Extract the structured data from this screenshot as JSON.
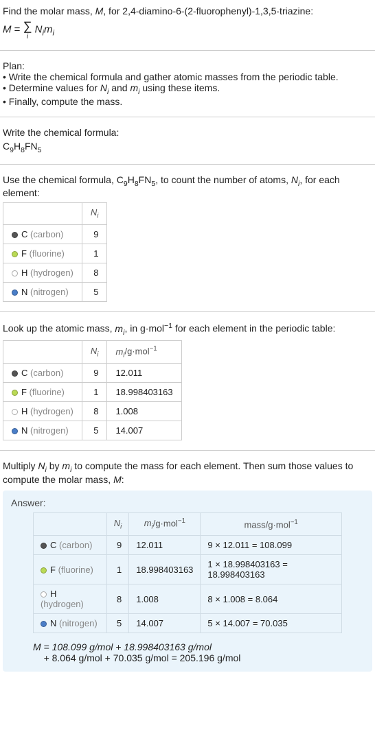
{
  "intro": {
    "line1_prefix": "Find the molar mass, ",
    "M": "M",
    "line1_suffix": ", for 2,4-diamino-6-(2-fluorophenyl)-1,3,5-triazine:",
    "eq_left": "M",
    "eq_eq": " = ",
    "sigma_i": "i",
    "eq_right1": "N",
    "eq_right2": "m",
    "eq_sub": "i"
  },
  "plan": {
    "title": "Plan:",
    "b1": "• Write the chemical formula and gather atomic masses from the periodic table.",
    "b2_prefix": "• Determine values for ",
    "Ni": "N",
    "mi": "m",
    "isub": "i",
    "b2_suffix": " using these items.",
    "b3": "• Finally, compute the mass."
  },
  "formula_section": {
    "title": "Write the chemical formula:",
    "C": "C",
    "C_n": "9",
    "H": "H",
    "H_n": "8",
    "F": "F",
    "N": "N",
    "N_n": "5"
  },
  "count_section": {
    "prefix": "Use the chemical formula, ",
    "suffix1": ", to count the number of atoms, ",
    "Ni": "N",
    "isub": "i",
    "suffix2": ", for each element:",
    "col_N": "N",
    "rows": [
      {
        "dot": "dot-c",
        "sym": "C",
        "name": "(carbon)",
        "n": "9"
      },
      {
        "dot": "dot-f",
        "sym": "F",
        "name": "(fluorine)",
        "n": "1"
      },
      {
        "dot": "dot-h",
        "sym": "H",
        "name": "(hydrogen)",
        "n": "8"
      },
      {
        "dot": "dot-n",
        "sym": "N",
        "name": "(nitrogen)",
        "n": "5"
      }
    ]
  },
  "mass_section": {
    "prefix": "Look up the atomic mass, ",
    "mi": "m",
    "isub": "i",
    "suffix": ", in g·mol",
    "exp": "−1",
    "suffix2": " for each element in the periodic table:",
    "col_N": "N",
    "col_m": "m",
    "col_m_unit": "/g·mol",
    "rows": [
      {
        "dot": "dot-c",
        "sym": "C",
        "name": "(carbon)",
        "n": "9",
        "m": "12.011"
      },
      {
        "dot": "dot-f",
        "sym": "F",
        "name": "(fluorine)",
        "n": "1",
        "m": "18.998403163"
      },
      {
        "dot": "dot-h",
        "sym": "H",
        "name": "(hydrogen)",
        "n": "8",
        "m": "1.008"
      },
      {
        "dot": "dot-n",
        "sym": "N",
        "name": "(nitrogen)",
        "n": "5",
        "m": "14.007"
      }
    ]
  },
  "multiply_section": {
    "prefix": "Multiply ",
    "Ni": "N",
    "mi": "m",
    "isub": "i",
    "mid": " by ",
    "suffix": " to compute the mass for each element. Then sum those values to compute the molar mass, ",
    "M": "M",
    "end": ":"
  },
  "answer": {
    "title": "Answer:",
    "col_N": "N",
    "col_m": "m",
    "unit": "/g·mol",
    "exp": "−1",
    "col_mass": "mass/g·mol",
    "rows": [
      {
        "dot": "dot-c",
        "sym": "C",
        "name": "(carbon)",
        "n": "9",
        "m": "12.011",
        "mass": "9 × 12.011 = 108.099"
      },
      {
        "dot": "dot-f",
        "sym": "F",
        "name": "(fluorine)",
        "n": "1",
        "m": "18.998403163",
        "mass": "1 × 18.998403163 = 18.998403163"
      },
      {
        "dot": "dot-h",
        "sym": "H",
        "name": "(hydrogen)",
        "n": "8",
        "m": "1.008",
        "mass": "8 × 1.008 = 8.064"
      },
      {
        "dot": "dot-n",
        "sym": "N",
        "name": "(nitrogen)",
        "n": "5",
        "m": "14.007",
        "mass": "5 × 14.007 = 70.035"
      }
    ],
    "final1": "M = 108.099 g/mol + 18.998403163 g/mol",
    "final2": "+ 8.064 g/mol + 70.035 g/mol = 205.196 g/mol"
  },
  "chart_data": {
    "type": "table",
    "title": "Molar mass computation for C9H8FN5",
    "elements": [
      {
        "element": "C (carbon)",
        "N_i": 9,
        "m_i_g_per_mol": 12.011,
        "mass_g_per_mol": 108.099
      },
      {
        "element": "F (fluorine)",
        "N_i": 1,
        "m_i_g_per_mol": 18.998403163,
        "mass_g_per_mol": 18.998403163
      },
      {
        "element": "H (hydrogen)",
        "N_i": 8,
        "m_i_g_per_mol": 1.008,
        "mass_g_per_mol": 8.064
      },
      {
        "element": "N (nitrogen)",
        "N_i": 5,
        "m_i_g_per_mol": 14.007,
        "mass_g_per_mol": 70.035
      }
    ],
    "molar_mass_g_per_mol": 205.196
  }
}
